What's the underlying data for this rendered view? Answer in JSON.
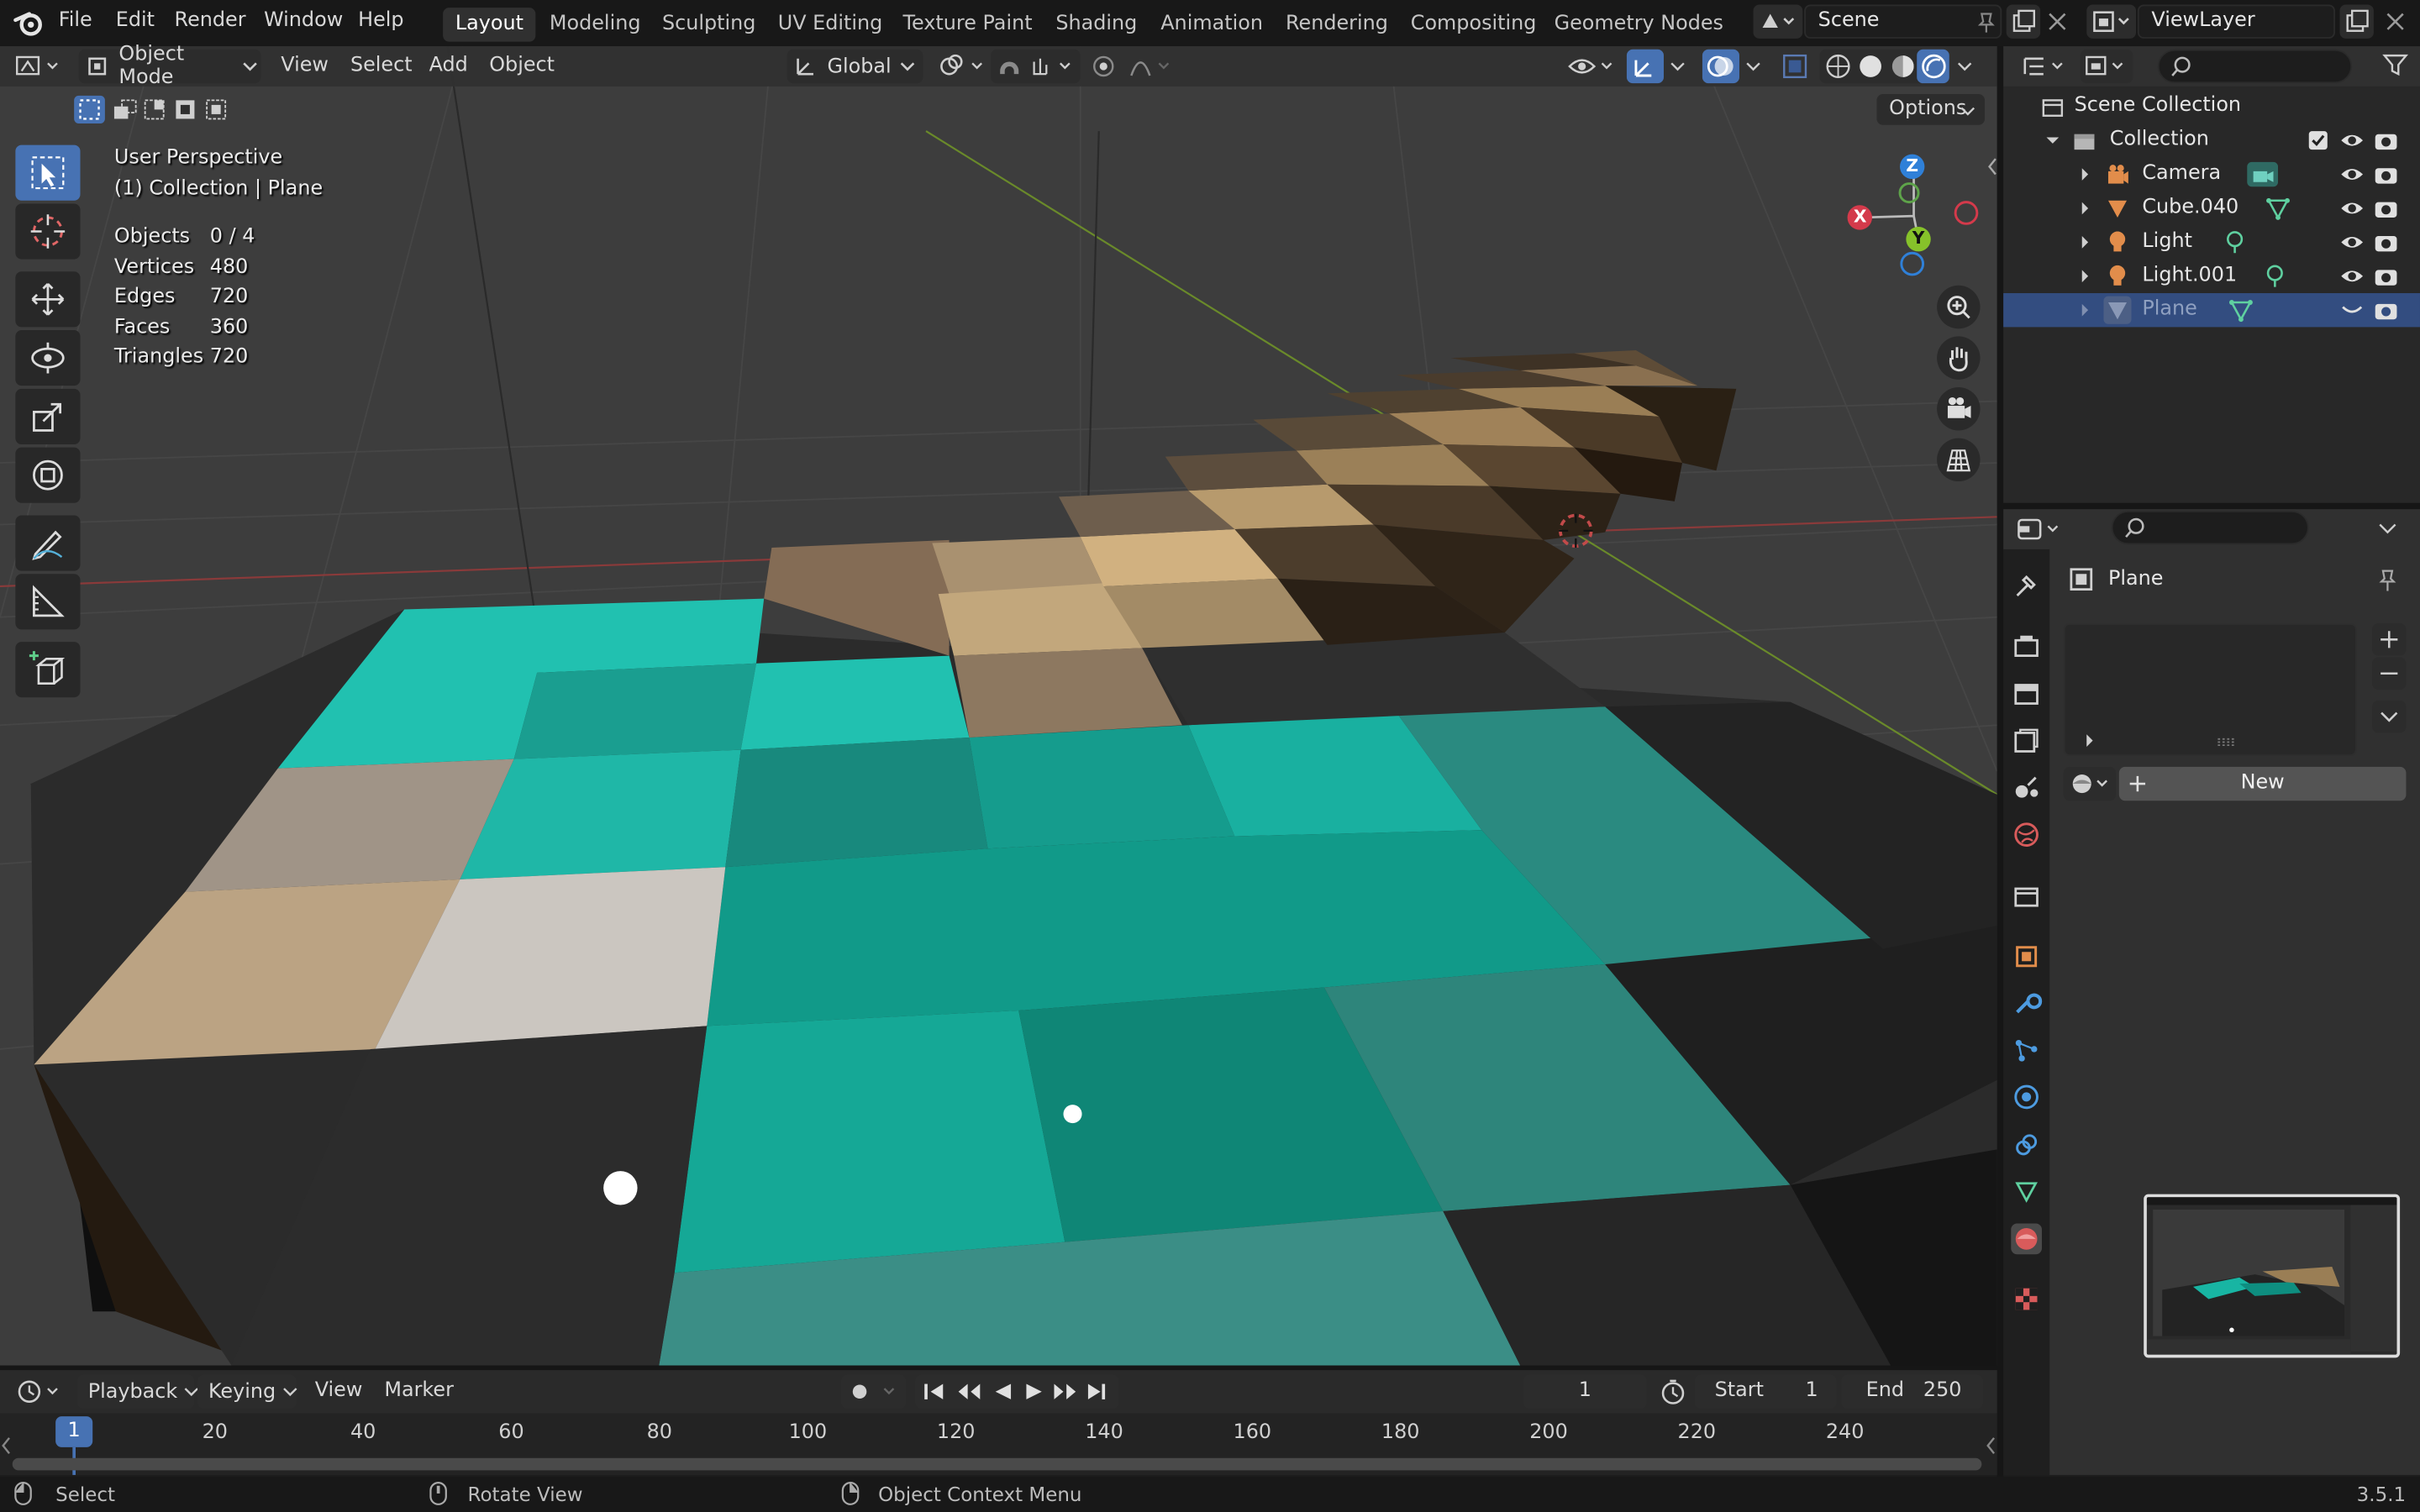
{
  "menu": {
    "items": [
      "File",
      "Edit",
      "Render",
      "Window",
      "Help"
    ]
  },
  "workspaces": [
    "Layout",
    "Modeling",
    "Sculpting",
    "UV Editing",
    "Texture Paint",
    "Shading",
    "Animation",
    "Rendering",
    "Compositing",
    "Geometry Nodes"
  ],
  "scene": {
    "name": "Scene"
  },
  "view_layer": {
    "name": "ViewLayer"
  },
  "viewport_header": {
    "mode": "Object Mode",
    "menus": [
      "View",
      "Select",
      "Add",
      "Object"
    ],
    "orientation": "Global",
    "options_label": "Options"
  },
  "viewport_overlay": {
    "perspective": "User Perspective",
    "context": "(1) Collection | Plane",
    "stats": [
      {
        "label": "Objects",
        "value": "0 / 4"
      },
      {
        "label": "Vertices",
        "value": "480"
      },
      {
        "label": "Edges",
        "value": "720"
      },
      {
        "label": "Faces",
        "value": "360"
      },
      {
        "label": "Triangles",
        "value": "720"
      }
    ]
  },
  "gizmo": {
    "x": "X",
    "y": "Y",
    "z": "Z"
  },
  "outliner": {
    "root": "Scene Collection",
    "collection": "Collection",
    "items": [
      {
        "name": "Camera",
        "icon": "camera-icon"
      },
      {
        "name": "Cube.040",
        "icon": "mesh-icon"
      },
      {
        "name": "Light",
        "icon": "light-icon"
      },
      {
        "name": "Light.001",
        "icon": "light-icon"
      },
      {
        "name": "Plane",
        "icon": "mesh-icon",
        "selected": true
      }
    ]
  },
  "properties": {
    "object_name": "Plane",
    "new_label": "New"
  },
  "timeline": {
    "menus": [
      "Playback",
      "Keying",
      "View",
      "Marker"
    ],
    "current_frame": "1",
    "start_label": "Start",
    "start_value": "1",
    "end_label": "End",
    "end_value": "250",
    "playhead": "1",
    "ticks": [
      "20",
      "40",
      "60",
      "80",
      "100",
      "120",
      "140",
      "160",
      "180",
      "200",
      "220",
      "240"
    ]
  },
  "status": {
    "select": "Select",
    "rotate": "Rotate View",
    "context_menu": "Object Context Menu",
    "version": "3.5.1"
  },
  "colors": {
    "accent": "#4772b3",
    "selection": "#334d80",
    "teal": "#17a99a",
    "tan": "#b79a6d"
  }
}
